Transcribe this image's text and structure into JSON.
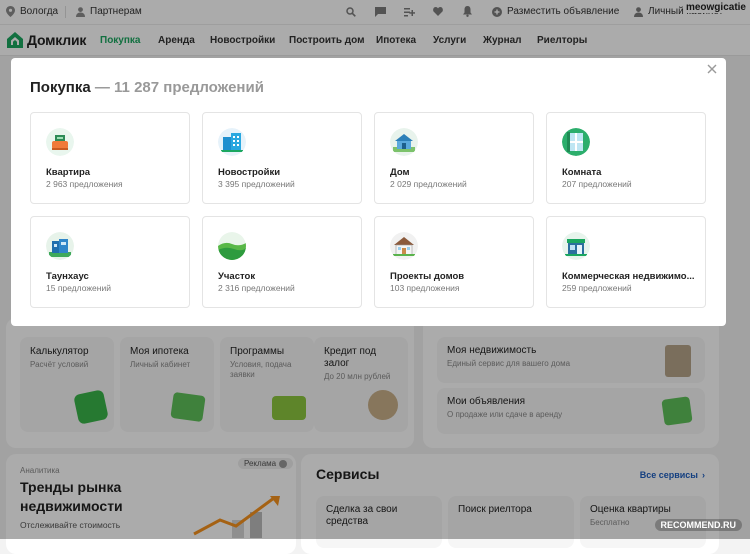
{
  "topbar": {
    "city": "Вологда",
    "partners": "Партнерам",
    "post_ad": "Разместить объявление",
    "cabinet": "Личный кабинет"
  },
  "username": "meowgicatie",
  "nav": {
    "logo": "Домклик",
    "items": [
      "Покупка",
      "Аренда",
      "Новостройки",
      "Построить дом",
      "Ипотека",
      "Услуги",
      "Журнал",
      "Риелторы"
    ]
  },
  "background": {
    "tools": [
      {
        "title": "Калькулятор",
        "subtitle": "Расчёт условий"
      },
      {
        "title": "Моя ипотека",
        "subtitle": "Личный кабинет"
      },
      {
        "title": "Программы",
        "subtitle": "Условия, подача заявки"
      },
      {
        "title": "Кредит под залог",
        "subtitle": "До 20 млн рублей"
      }
    ],
    "right_tiles": [
      {
        "title": "Моя недвижимость",
        "subtitle": "Единый сервис для вашего дома"
      },
      {
        "title": "Мои объявления",
        "subtitle": "О продаже или сдаче в аренду"
      }
    ],
    "analytics": {
      "tag": "Аналитика",
      "badge": "Реклама",
      "title": "Тренды рынка недвижимости",
      "subtitle": "Отслеживайте стоимость"
    },
    "services": {
      "title": "Сервисы",
      "all_link": "Все сервисы",
      "items": [
        "Сделка за свои средства",
        "Поиск риелтора",
        "Оценка квартиры"
      ],
      "item3_sub": "Бесплатно"
    }
  },
  "modal": {
    "title": "Покупка",
    "count": " — 11 287 предложений",
    "categories": [
      {
        "name": "Квартира",
        "count": "2 963 предложения",
        "icon": "apartment-icon"
      },
      {
        "name": "Новостройки",
        "count": "3 395 предложений",
        "icon": "new-building-icon"
      },
      {
        "name": "Дом",
        "count": "2 029 предложений",
        "icon": "house-icon"
      },
      {
        "name": "Комната",
        "count": "207 предложений",
        "icon": "room-icon"
      },
      {
        "name": "Таунхаус",
        "count": "15 предложений",
        "icon": "townhouse-icon"
      },
      {
        "name": "Участок",
        "count": "2 316 предложений",
        "icon": "land-plot-icon"
      },
      {
        "name": "Проекты домов",
        "count": "103 предложения",
        "icon": "house-project-icon"
      },
      {
        "name": "Коммерческая недвижимо...",
        "count": "259 предложений",
        "icon": "commercial-icon"
      }
    ]
  },
  "watermark": "RECOMMEND.RU",
  "colors": {
    "accent": "#1ba760",
    "overlay": "rgba(0,0,0,0.33)"
  }
}
